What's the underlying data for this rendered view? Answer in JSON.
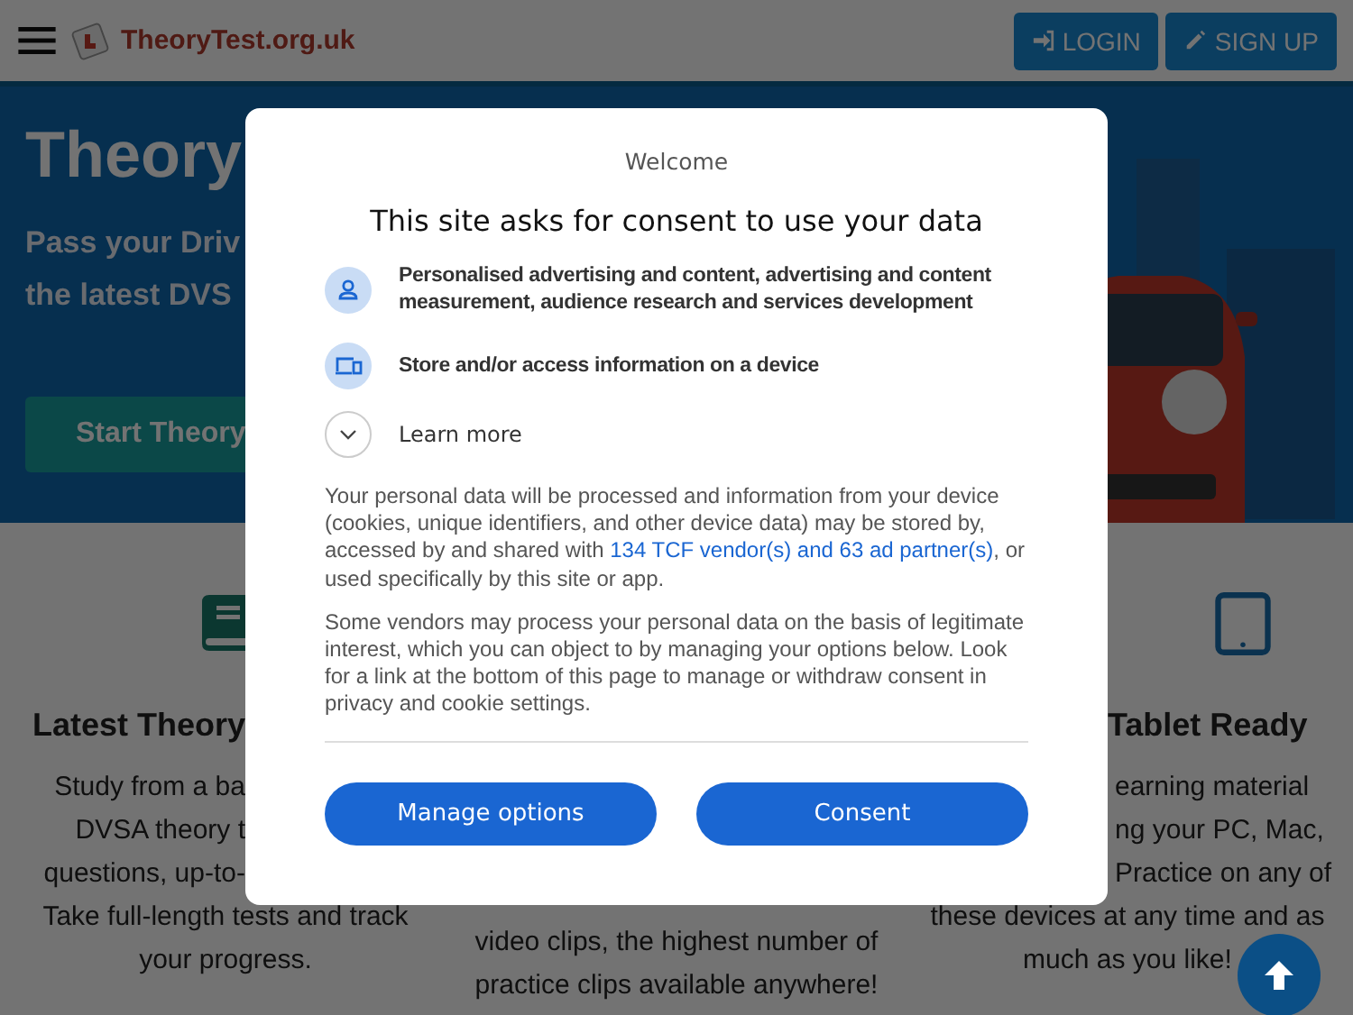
{
  "header": {
    "site_name": "TheoryTest.org.uk",
    "buttons": [
      {
        "label": "LOGIN"
      },
      {
        "label": "SIGN UP"
      }
    ]
  },
  "hero": {
    "title": "Theory",
    "subtitle_lines": [
      "Pass your Driv",
      "the latest DVS"
    ],
    "button": "Start Theory"
  },
  "features": [
    {
      "heading": {
        "text": "Latest Theory",
        "kind": "cut_end"
      },
      "lines": [
        {
          "text": "Study from a ba",
          "kind": "cut_end"
        },
        {
          "text": "DVSA theory t",
          "kind": "cut_end"
        },
        {
          "text": "questions, up-to-",
          "kind": "cut_end"
        },
        {
          "text": "Take full-length tests and track",
          "kind": "full"
        },
        {
          "text": "your progress.",
          "kind": "full"
        }
      ]
    },
    {
      "lines": [
        {
          "text": "video clips, the highest number of",
          "kind": "full"
        },
        {
          "text": "practice clips available anywhere!",
          "kind": "full"
        }
      ]
    },
    {
      "heading": {
        "text": "Tablet Ready",
        "kind": "cut_start"
      },
      "lines": [
        {
          "text": "earning material",
          "kind": "cut_start"
        },
        {
          "text": "ng your PC, Mac,",
          "kind": "cut_start"
        },
        {
          "text": "Practice on any of",
          "kind": "cut_start"
        },
        {
          "text": "these devices at any time and as",
          "kind": "full"
        },
        {
          "text": "much as you like!",
          "kind": "full"
        }
      ]
    }
  ],
  "dialog": {
    "overline": "Welcome",
    "title": "This site asks for consent to use your data",
    "purposes": [
      {
        "text": "Personalised advertising and content, advertising and content measurement, audience research and services development"
      },
      {
        "text": "Store and/or access information on a device"
      }
    ],
    "learn_more": {
      "label": "Learn more",
      "expanded": false
    },
    "notice": {
      "before": "Your personal data will be processed and information from your device (cookies, unique identifiers, and other device data) may be stored by, accessed by and shared with ",
      "link": "134 TCF vendor(s) and 63 ad partner(s)",
      "after": ", or used specifically by this site or app."
    },
    "paragraph": "Some vendors may process your personal data on the basis of legitimate interest, which you can object to by managing your options below. Look for a link at the bottom of this page to manage or withdraw consent in privacy and cookie settings.",
    "buttons": [
      "Manage options",
      "Consent"
    ]
  }
}
